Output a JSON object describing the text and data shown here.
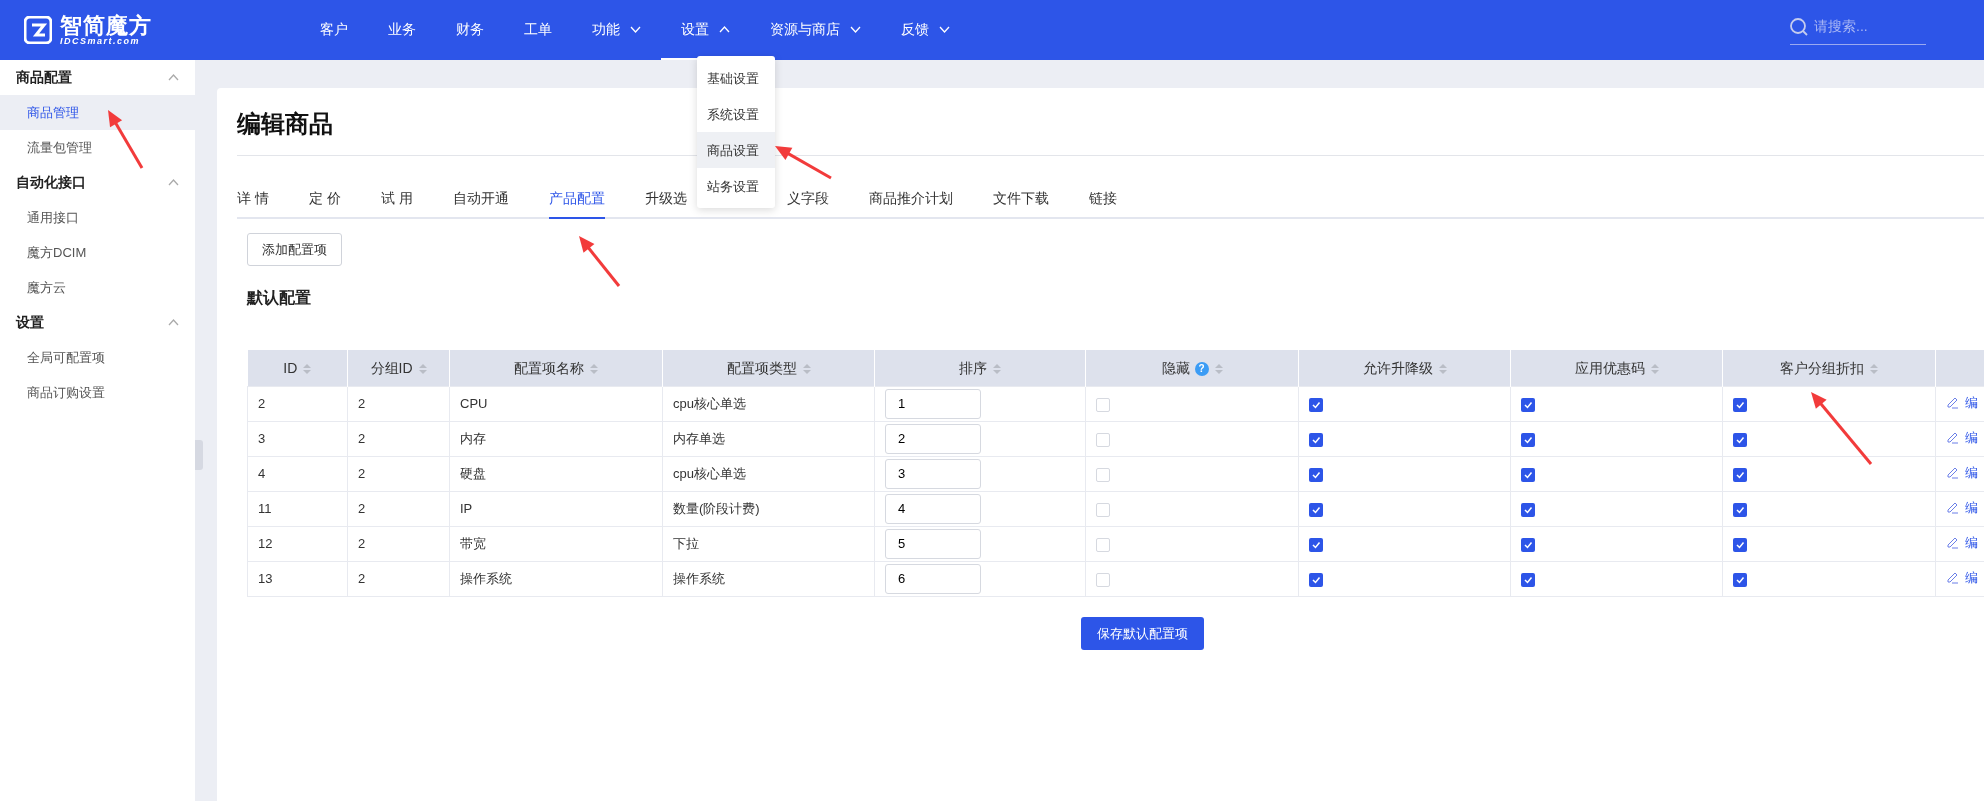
{
  "logo": {
    "name": "智简魔方",
    "domain": "IDCSmart.com"
  },
  "nav": [
    {
      "label": "客户",
      "selected": false,
      "dropdown": false
    },
    {
      "label": "业务",
      "selected": false,
      "dropdown": false
    },
    {
      "label": "财务",
      "selected": false,
      "dropdown": false
    },
    {
      "label": "工单",
      "selected": false,
      "dropdown": false
    },
    {
      "label": "功能",
      "selected": false,
      "dropdown": true
    },
    {
      "label": "设置",
      "selected": true,
      "dropdown": true,
      "expanded": true,
      "menu": [
        {
          "label": "基础设置",
          "selected": false
        },
        {
          "label": "系统设置",
          "selected": false
        },
        {
          "label": "商品设置",
          "selected": true,
          "arrow": true
        },
        {
          "label": "站务设置",
          "selected": false
        }
      ]
    },
    {
      "label": "资源与商店",
      "selected": false,
      "dropdown": true
    },
    {
      "label": "反馈",
      "selected": false,
      "dropdown": true
    }
  ],
  "search": {
    "placeholder": "请搜索..."
  },
  "sidebar": [
    {
      "label": "商品配置",
      "expanded": true,
      "children": [
        {
          "label": "商品管理",
          "selected": true,
          "arrow": true
        },
        {
          "label": "流量包管理",
          "selected": false
        }
      ]
    },
    {
      "label": "自动化接口",
      "expanded": true,
      "children": [
        {
          "label": "通用接口",
          "selected": false
        },
        {
          "label": "魔方DCIM",
          "selected": false
        },
        {
          "label": "魔方云",
          "selected": false
        }
      ]
    },
    {
      "label": "设置",
      "expanded": true,
      "children": [
        {
          "label": "全局可配置项",
          "selected": false
        },
        {
          "label": "商品订购设置",
          "selected": false
        }
      ]
    }
  ],
  "page_title": "编辑商品",
  "tabs": [
    {
      "label": "详 情",
      "selected": false
    },
    {
      "label": "定 价",
      "selected": false
    },
    {
      "label": "试 用",
      "selected": false
    },
    {
      "label": "自动开通",
      "selected": false
    },
    {
      "label": "产品配置",
      "selected": true,
      "arrow": true
    },
    {
      "label": "升级选",
      "selected": false
    },
    {
      "label": "义字段",
      "selected": false
    },
    {
      "label": "商品推介计划",
      "selected": false
    },
    {
      "label": "文件下载",
      "selected": false
    },
    {
      "label": "链接",
      "selected": false
    }
  ],
  "add_button": "添加配置项",
  "section_title": "默认配置",
  "table": {
    "columns": [
      {
        "label": "ID"
      },
      {
        "label": "分组ID"
      },
      {
        "label": "配置项名称"
      },
      {
        "label": "配置项类型"
      },
      {
        "label": "排序"
      },
      {
        "label": "隐藏",
        "help": true
      },
      {
        "label": "允许升降级"
      },
      {
        "label": "应用优惠码"
      },
      {
        "label": "客户分组折扣",
        "arrow": true
      }
    ],
    "help_icon": "?",
    "rows": [
      {
        "id": "2",
        "group_id": "2",
        "name": "CPU",
        "type": "cpu核心单选",
        "order": "1",
        "hidden": false,
        "upgrade": true,
        "coupon": true,
        "discount": true,
        "action": "编"
      },
      {
        "id": "3",
        "group_id": "2",
        "name": "内存",
        "type": "内存单选",
        "order": "2",
        "hidden": false,
        "upgrade": true,
        "coupon": true,
        "discount": true,
        "action": "编"
      },
      {
        "id": "4",
        "group_id": "2",
        "name": "硬盘",
        "type": "cpu核心单选",
        "order": "3",
        "hidden": false,
        "upgrade": true,
        "coupon": true,
        "discount": true,
        "action": "编"
      },
      {
        "id": "11",
        "group_id": "2",
        "name": "IP",
        "type": "数量(阶段计费)",
        "order": "4",
        "hidden": false,
        "upgrade": true,
        "coupon": true,
        "discount": true,
        "action": "编"
      },
      {
        "id": "12",
        "group_id": "2",
        "name": "带宽",
        "type": "下拉",
        "order": "5",
        "hidden": false,
        "upgrade": true,
        "coupon": true,
        "discount": true,
        "action": "编"
      },
      {
        "id": "13",
        "group_id": "2",
        "name": "操作系统",
        "type": "操作系统",
        "order": "6",
        "hidden": false,
        "upgrade": true,
        "coupon": true,
        "discount": true,
        "action": "编"
      }
    ]
  },
  "save_button": "保存默认配置项"
}
